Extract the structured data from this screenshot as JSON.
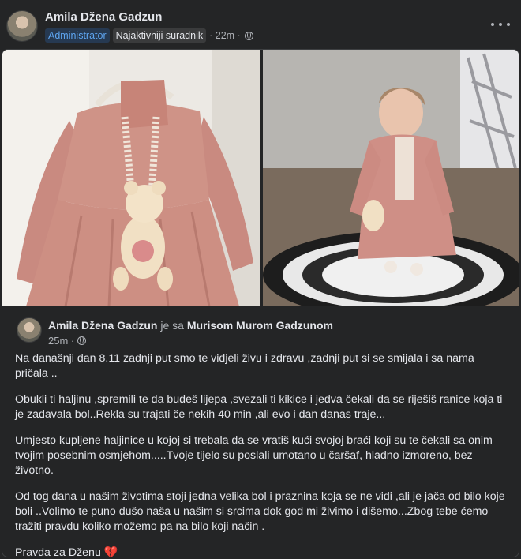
{
  "post": {
    "author": "Amila Džena Gadzun",
    "badge_admin": "Administrator",
    "badge_active": "Najaktivniji suradnik",
    "time": "· 22m ·",
    "more_icon": "more-horizontal-icon"
  },
  "shared": {
    "author": "Amila Džena Gadzun",
    "with_text": "je sa",
    "tagged": "Murisom Murom Gadzunom",
    "time": "25m ·",
    "paragraphs": [
      "Na današnji dan 8.11 zadnji put smo te vidjeli živu i zdravu ,zadnji put si se smijala i sa nama pričala ..",
      "Obukli ti haljinu ,spremili te da budeš lijepa ,svezali ti kikice i  jedva čekali da se riješiš ranice koja ti je zadavala bol..Rekla su trajati če nekih 40 min ,ali evo i dan danas traje...",
      "Umjesto kupljene haljinice u kojoj si trebala da se vratiš kući svojoj braći koji su te čekali  sa onim tvojim posebnim osmjehom.....Tvoje tijelo su poslali umotano u čaršaf, hladno izmoreno, bez životno.",
      "Od tog dana u našim životima stoji jedna velika bol i praznina koja se ne vidi ,ali je jača od bilo koje boli ..Volimo te puno dušo naša u našim si srcima dok god mi živimo i dišemo...Zbog tebe ćemo tražiti pravdu koliko možemo pa na bilo koji način ."
    ],
    "closing": "Pravda za Dženu",
    "closing_emoji": "💔"
  },
  "colors": {
    "background": "#242526",
    "admin_badge_text": "#5ea5f0",
    "heart": "#e0245e"
  }
}
